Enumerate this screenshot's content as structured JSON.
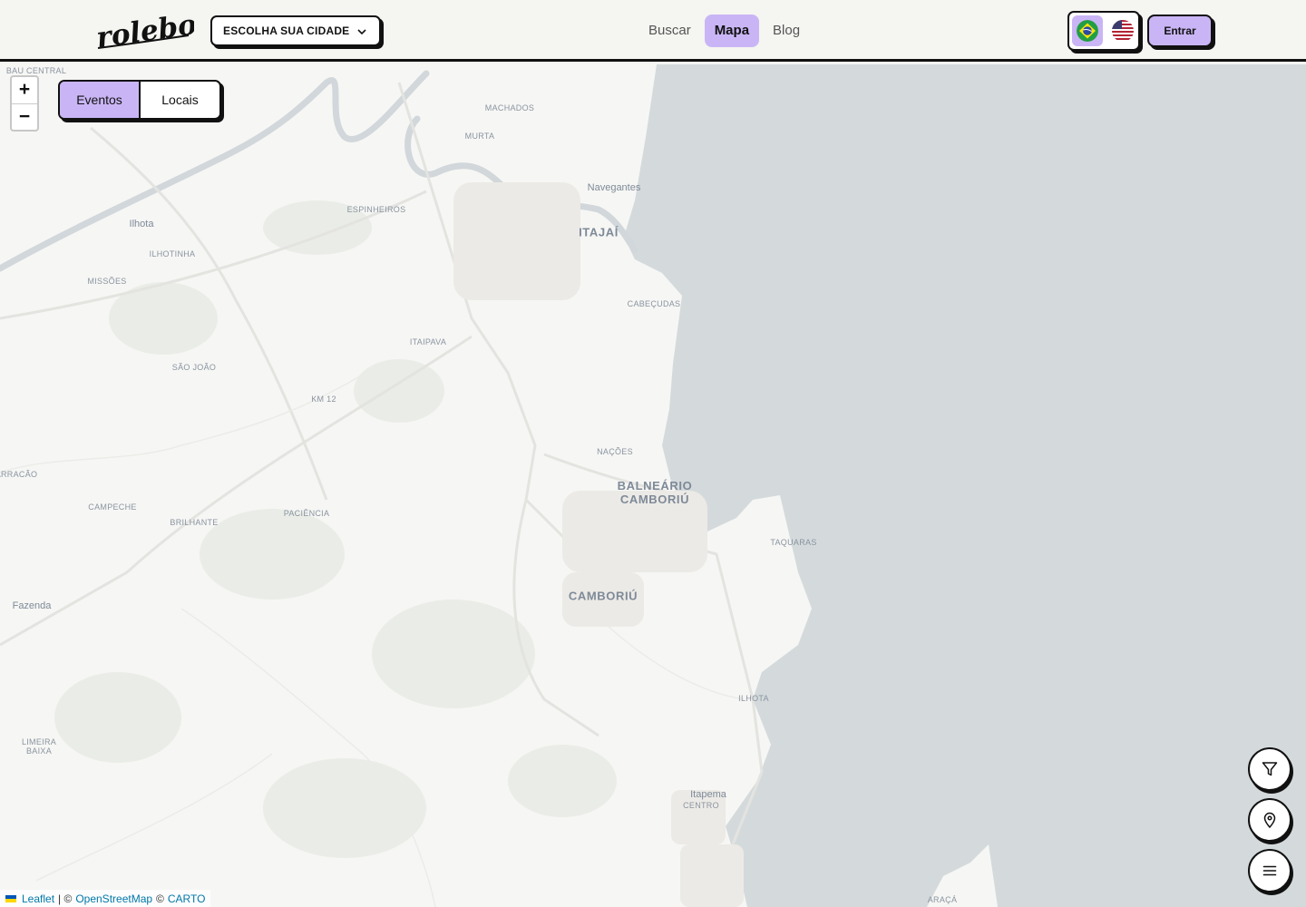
{
  "header": {
    "logo_text": "rolebom",
    "city_select": {
      "label": "ESCOLHA SUA CIDADE"
    },
    "nav": [
      {
        "label": "Buscar",
        "active": false
      },
      {
        "label": "Mapa",
        "active": true
      },
      {
        "label": "Blog",
        "active": false
      }
    ],
    "language": {
      "options": [
        "pt-BR",
        "en-US"
      ],
      "selected": "pt-BR"
    },
    "login_label": "Entrar"
  },
  "map": {
    "zoom_in": "+",
    "zoom_out": "−",
    "view_toggle": [
      {
        "label": "Eventos",
        "active": true
      },
      {
        "label": "Locais",
        "active": false
      }
    ],
    "places": [
      {
        "name": "BAU CENTRAL",
        "kind": "neighborhood"
      },
      {
        "name": "MACHADOS",
        "kind": "neighborhood"
      },
      {
        "name": "MURTA",
        "kind": "neighborhood"
      },
      {
        "name": "Navegantes",
        "kind": "town"
      },
      {
        "name": "ITAJAÍ",
        "kind": "city"
      },
      {
        "name": "ESPINHEIROS",
        "kind": "neighborhood"
      },
      {
        "name": "Ilhota",
        "kind": "town"
      },
      {
        "name": "ILHOTINHA",
        "kind": "neighborhood"
      },
      {
        "name": "MISSÕES",
        "kind": "neighborhood"
      },
      {
        "name": "CABEÇUDAS",
        "kind": "neighborhood"
      },
      {
        "name": "ITAIPAVA",
        "kind": "neighborhood"
      },
      {
        "name": "SÃO JOÃO",
        "kind": "neighborhood"
      },
      {
        "name": "KM 12",
        "kind": "neighborhood"
      },
      {
        "name": "NAÇÕES",
        "kind": "neighborhood"
      },
      {
        "name": "BALNEÁRIO CAMBORIÚ",
        "kind": "city"
      },
      {
        "name": "ARRACÃO",
        "kind": "neighborhood"
      },
      {
        "name": "CAMPECHE",
        "kind": "neighborhood"
      },
      {
        "name": "BRILHANTE",
        "kind": "neighborhood"
      },
      {
        "name": "PACIÊNCIA",
        "kind": "neighborhood"
      },
      {
        "name": "TAQUARAS",
        "kind": "neighborhood"
      },
      {
        "name": "CAMBORIÚ",
        "kind": "city"
      },
      {
        "name": "Fazenda",
        "kind": "town"
      },
      {
        "name": "ILHOTA",
        "kind": "neighborhood"
      },
      {
        "name": "LIMEIRA BAIXA",
        "kind": "neighborhood"
      },
      {
        "name": "Itapema",
        "kind": "town"
      },
      {
        "name": "CENTRO",
        "kind": "neighborhood"
      },
      {
        "name": "ARAÇÁ",
        "kind": "neighborhood"
      }
    ],
    "attribution": {
      "leaflet": "Leaflet",
      "sep": "| ©",
      "osm": "OpenStreetMap",
      "copy": "©",
      "carto": "CARTO"
    }
  },
  "actions": [
    {
      "name": "filter",
      "icon": "filter-icon"
    },
    {
      "name": "location",
      "icon": "map-pin-icon"
    },
    {
      "name": "menu",
      "icon": "menu-icon"
    }
  ],
  "colors": {
    "accent": "#c9b5f5",
    "sea": "#d4dadc",
    "land": "#f6f6f4",
    "border": "#111111"
  }
}
